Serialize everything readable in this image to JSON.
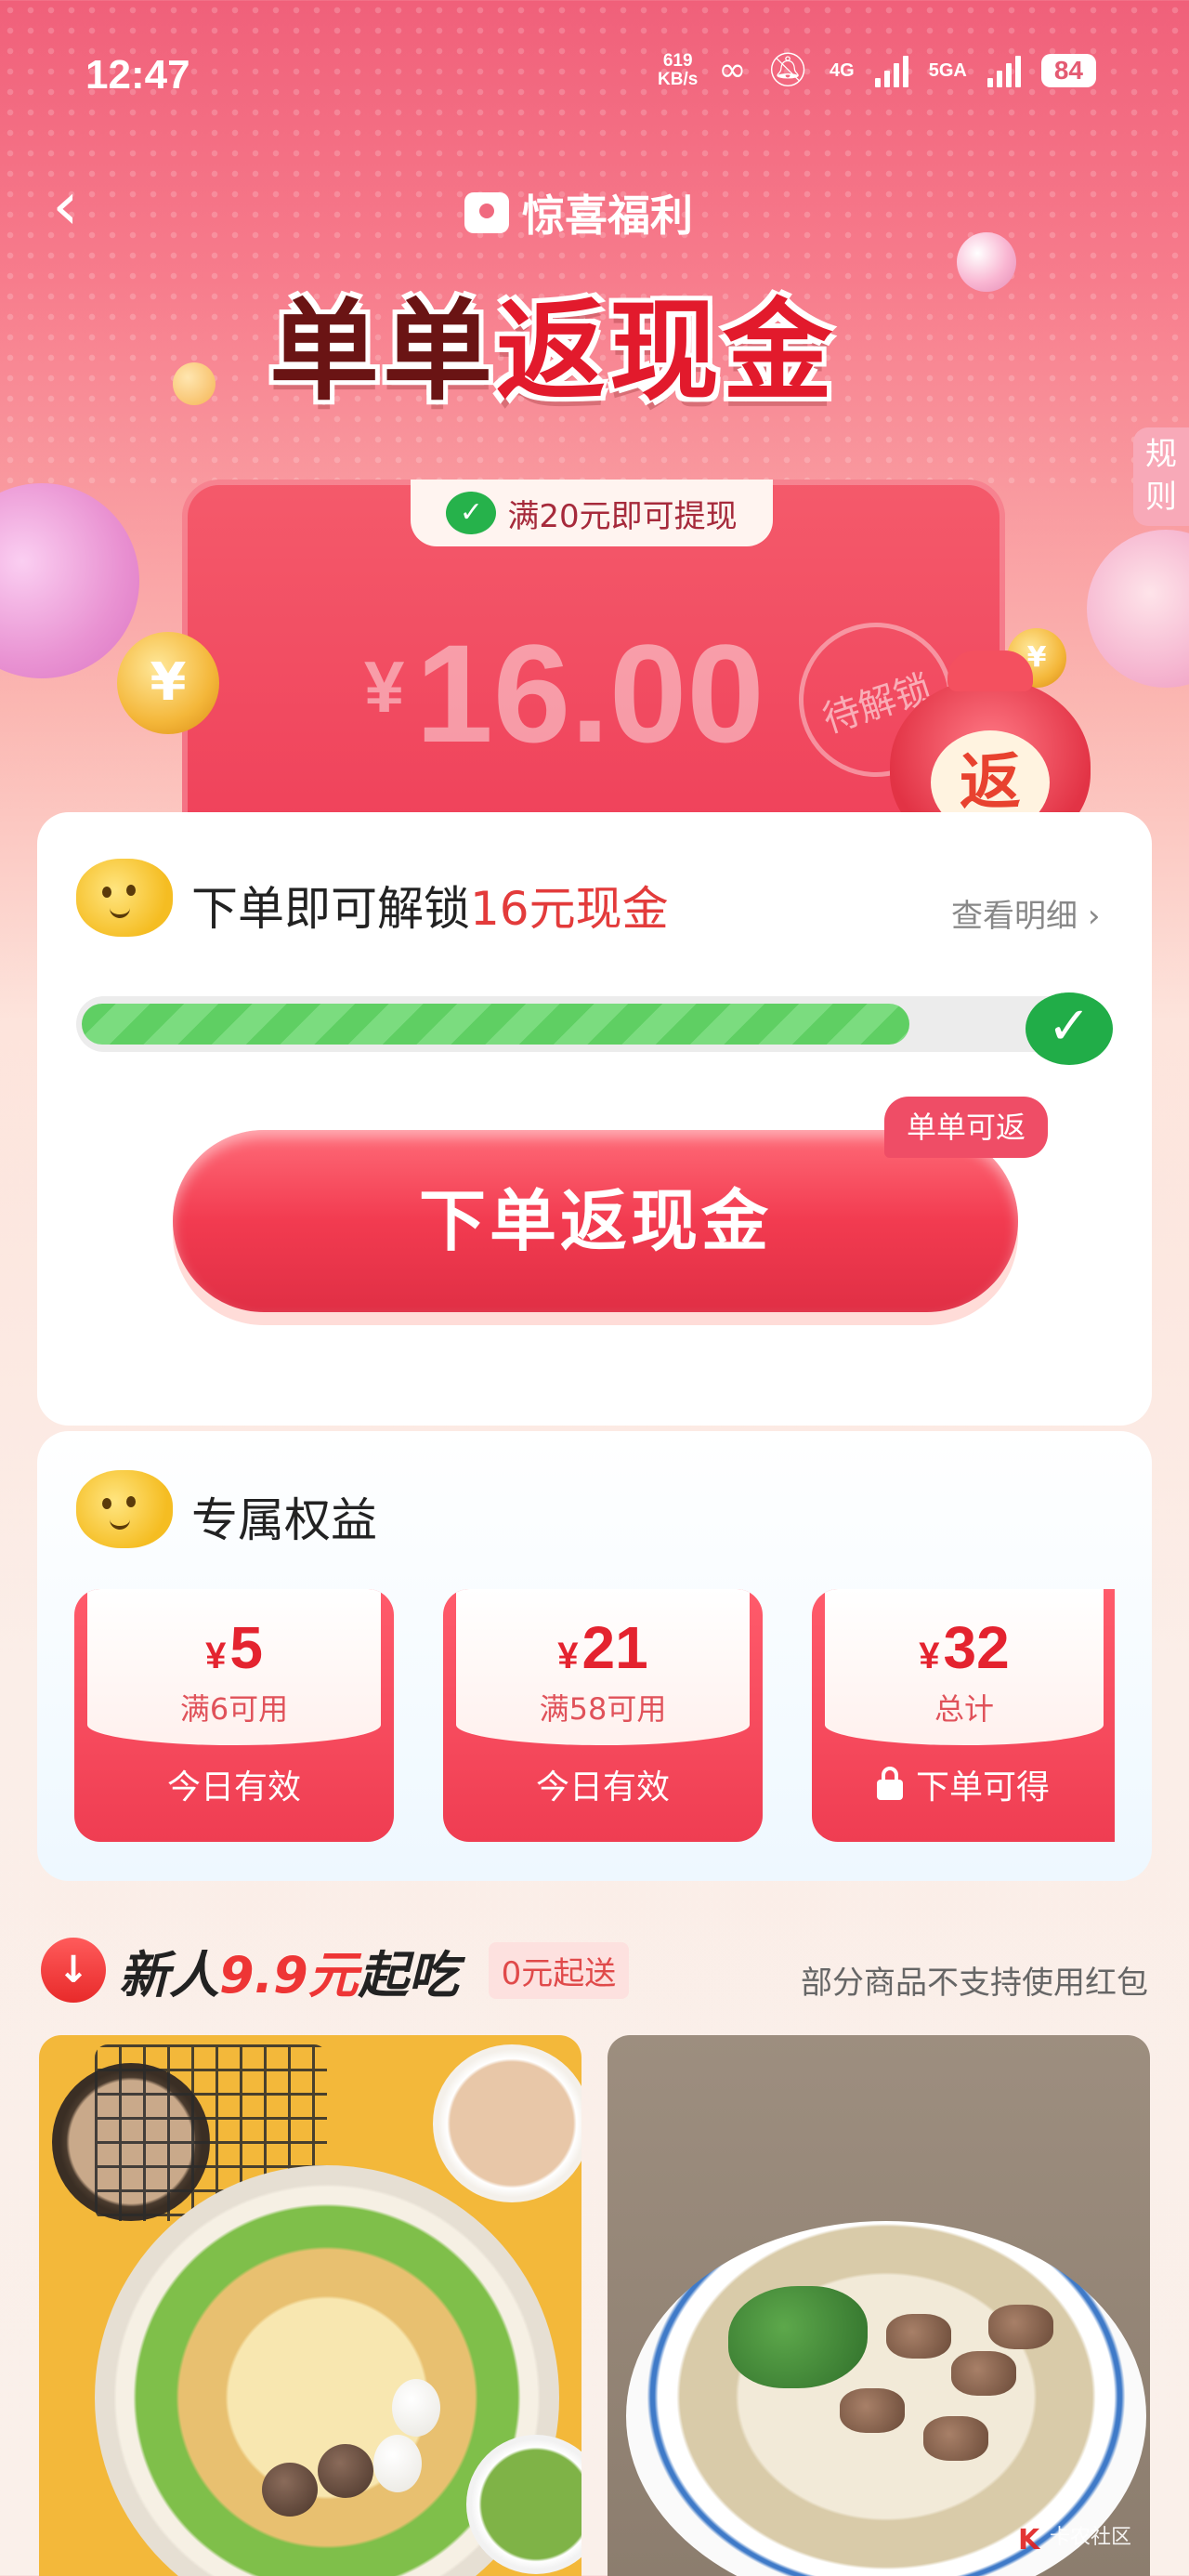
{
  "status_bar": {
    "time": "12:47",
    "net_speed_value": "619",
    "net_speed_unit": "KB/s",
    "signal_4g": "4G",
    "signal_5g": "5GA",
    "battery": "84"
  },
  "header": {
    "back_icon": "chevron-left-icon",
    "brand": "惊喜福利",
    "headline_part1": "单单",
    "headline_part2": "返现金",
    "rules_label": "规则"
  },
  "cash_card": {
    "notice": "满20元即可提现",
    "currency": "¥",
    "amount": "16.00",
    "stamp": "待解锁",
    "bag_label": "返"
  },
  "unlock": {
    "title_prefix": "下单即可解锁",
    "title_highlight": "16元现金",
    "detail_link": "查看明细",
    "progress": 0.82,
    "badge": "单单可返",
    "button": "下单返现金"
  },
  "benefits": {
    "title": "专属权益",
    "coupons": [
      {
        "currency": "¥",
        "amount": "5",
        "condition": "满6可用",
        "footer": "今日有效",
        "locked": false
      },
      {
        "currency": "¥",
        "amount": "21",
        "condition": "满58可用",
        "footer": "今日有效",
        "locked": false
      },
      {
        "currency": "¥",
        "amount": "32",
        "condition": "总计",
        "footer": "下单可得",
        "locked": true
      }
    ]
  },
  "newcomer": {
    "title_prefix": "新人",
    "title_highlight": "9.9元",
    "title_suffix": "起吃",
    "free_delivery": "0元起送",
    "note": "部分商品不支持使用红包"
  },
  "watermark": "卡农社区",
  "colors": {
    "accent_red": "#ef3d52",
    "progress_green": "#5fcf63",
    "check_green": "#21ad48"
  }
}
